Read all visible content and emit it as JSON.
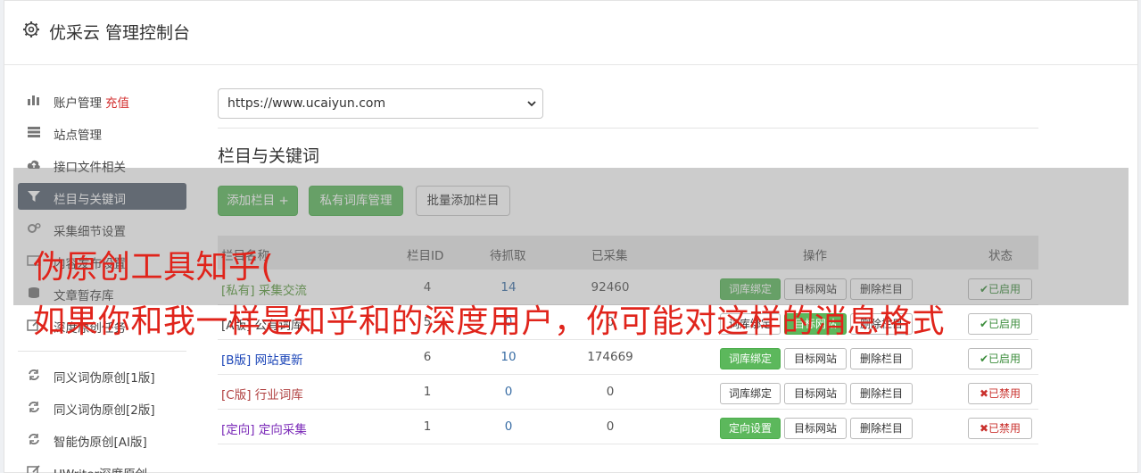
{
  "header": {
    "title": "优采云 管理控制台"
  },
  "sidebar": {
    "items": [
      {
        "label": "账户管理",
        "tag": "充值"
      },
      {
        "label": "站点管理"
      },
      {
        "label": "接口文件相关"
      },
      {
        "label": "栏目与关键词"
      },
      {
        "label": "采集细节设置"
      },
      {
        "label": "内容发布设置"
      },
      {
        "label": "文章暂存库"
      },
      {
        "label": "深度原创任务"
      },
      {
        "label": "同义词伪原创[1版]"
      },
      {
        "label": "同义词伪原创[2版]"
      },
      {
        "label": "智能伪原创[AI版]"
      },
      {
        "label": "UWriter深度原创"
      }
    ]
  },
  "site_select": {
    "value": "https://www.ucaiyun.com"
  },
  "section": {
    "title": "栏目与关键词"
  },
  "toolbar": {
    "add_column": "添加栏目 +",
    "private_lib": "私有词库管理",
    "batch_add": "批量添加栏目"
  },
  "table": {
    "headers": {
      "name": "栏目名称",
      "id": "栏目ID",
      "pending": "待抓取",
      "collected": "已采集",
      "actions": "操作",
      "status": "状态"
    },
    "rows": [
      {
        "name": "[私有] 采集交流",
        "id": "4",
        "pending": "14",
        "collected": "92460",
        "action1": "词库绑定",
        "action2": "目标网站",
        "action3": "删除栏目",
        "status": "已启用"
      },
      {
        "name": "[A版] 公有词库",
        "id": "5",
        "pending": "0",
        "collected": "0",
        "action1": "词库绑定",
        "action2": "目标网站",
        "action3": "删除栏目",
        "status": "已启用"
      },
      {
        "name": "[B版] 网站更新",
        "id": "6",
        "pending": "10",
        "collected": "174669",
        "action1": "词库绑定",
        "action2": "目标网站",
        "action3": "删除栏目",
        "status": "已启用"
      },
      {
        "name": "[C版] 行业词库",
        "id": "1",
        "pending": "0",
        "collected": "0",
        "action1": "词库绑定",
        "action2": "目标网站",
        "action3": "删除栏目",
        "status": "已禁用"
      },
      {
        "name": "[定向] 定向采集",
        "id": "1",
        "pending": "0",
        "collected": "0",
        "action1": "定向设置",
        "action2": "目标网站",
        "action3": "删除栏目",
        "status": "已禁用"
      }
    ]
  },
  "overlay": {
    "line1": "伪原创工具知乎(",
    "line2": "如果你和我一样是知乎和的深度用户，你可能对这样的消息格式"
  },
  "colors": {
    "accent_green": "#5cb85c",
    "active_nav": "#566270",
    "headline_red": "#e0241b"
  }
}
